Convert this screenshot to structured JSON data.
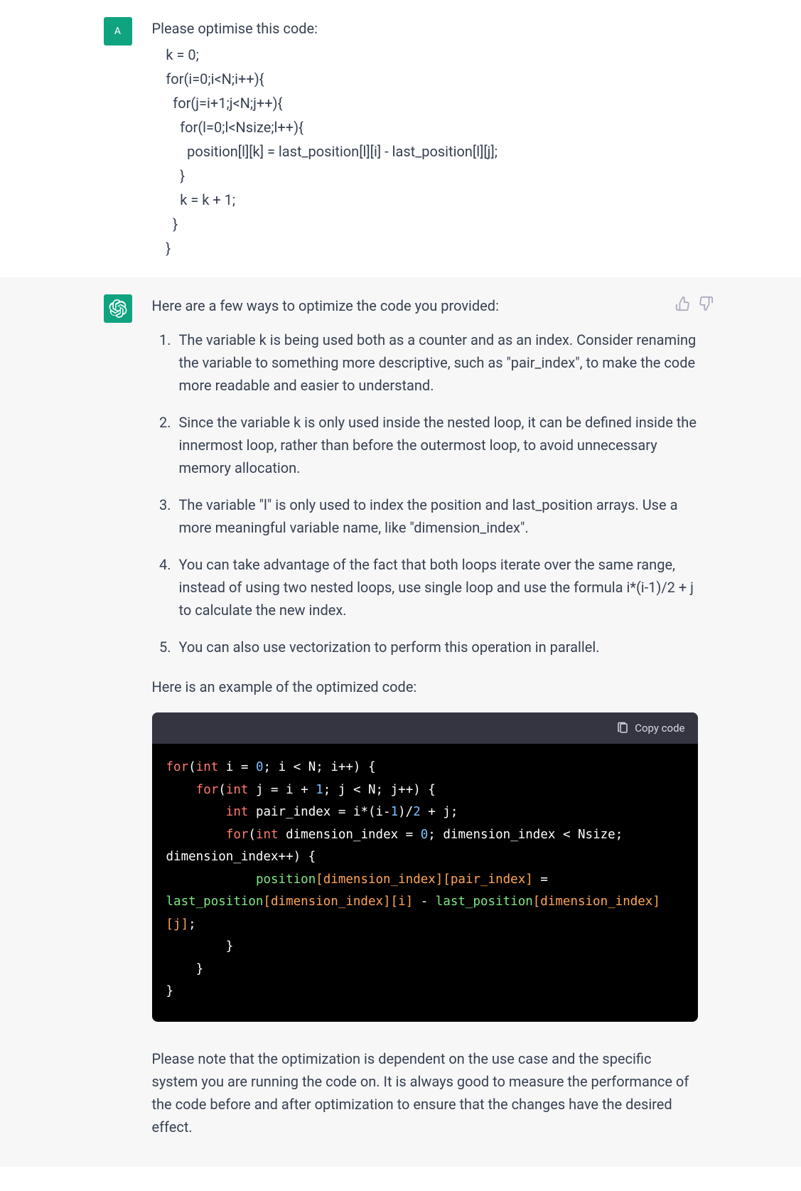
{
  "user": {
    "avatar_letter": "A",
    "prompt_intro": "Please optimise this code:",
    "code_lines": [
      "    k = 0;",
      "    for(i=0;i<N;i++){",
      "      for(j=i+1;j<N;j++){",
      "        for(l=0;l<Nsize;l++){",
      "          position[l][k] = last_position[l][i] - last_position[l][j];",
      "        }",
      "        k = k + 1;",
      "      }",
      "    }"
    ]
  },
  "assistant": {
    "intro": "Here are a few ways to optimize the code you provided:",
    "suggestions": [
      "The variable k is being used both as a counter and as an index. Consider renaming the variable to something more descriptive, such as \"pair_index\", to make the code more readable and easier to understand.",
      "Since the variable k is only used inside the nested loop, it can be defined inside the innermost loop, rather than before the outermost loop, to avoid unnecessary memory allocation.",
      "The variable \"l\" is only used to index the position and last_position arrays. Use a more meaningful variable name, like \"dimension_index\".",
      "You can take advantage of the fact that both loops iterate over the same range, instead of using two nested loops, use single loop and use the formula i*(i-1)/2 + j to calculate the new index.",
      "You can also use vectorization to perform this operation in parallel."
    ],
    "example_intro": "Here is an example of the optimized code:",
    "copy_label": "Copy code",
    "code_tokens": [
      [
        [
          "kw",
          "for"
        ],
        [
          "plain",
          "("
        ],
        [
          "kw",
          "int"
        ],
        [
          "plain",
          " i = "
        ],
        [
          "num",
          "0"
        ],
        [
          "plain",
          "; i < N; i++) {"
        ]
      ],
      [
        [
          "plain",
          "    "
        ],
        [
          "kw",
          "for"
        ],
        [
          "plain",
          "("
        ],
        [
          "kw",
          "int"
        ],
        [
          "plain",
          " j = i + "
        ],
        [
          "num",
          "1"
        ],
        [
          "plain",
          "; j < N; j++) {"
        ]
      ],
      [
        [
          "plain",
          "        "
        ],
        [
          "kw",
          "int"
        ],
        [
          "plain",
          " pair_index = i*(i-"
        ],
        [
          "num",
          "1"
        ],
        [
          "plain",
          ")/"
        ],
        [
          "num",
          "2"
        ],
        [
          "plain",
          " + j;"
        ]
      ],
      [
        [
          "plain",
          "        "
        ],
        [
          "kw",
          "for"
        ],
        [
          "plain",
          "("
        ],
        [
          "kw",
          "int"
        ],
        [
          "plain",
          " dimension_index = "
        ],
        [
          "num",
          "0"
        ],
        [
          "plain",
          "; dimension_index < Nsize; dimension_index++) {"
        ]
      ],
      [
        [
          "plain",
          "            "
        ],
        [
          "fn",
          "position"
        ],
        [
          "br",
          "[dimension_index][pair_index]"
        ],
        [
          "plain",
          " = "
        ],
        [
          "fn",
          "last_position"
        ],
        [
          "br",
          "[dimension_index][i]"
        ],
        [
          "plain",
          " - "
        ],
        [
          "fn",
          "last_position"
        ],
        [
          "br",
          "[dimension_index][j]"
        ],
        [
          "plain",
          ";"
        ]
      ],
      [
        [
          "plain",
          "        }"
        ]
      ],
      [
        [
          "plain",
          "    }"
        ]
      ],
      [
        [
          "plain",
          "}"
        ]
      ]
    ],
    "closing": "Please note that the optimization is dependent on the use case and the specific system you are running the code on. It is always good to measure the performance of the code before and after optimization to ensure that the changes have the desired effect."
  }
}
